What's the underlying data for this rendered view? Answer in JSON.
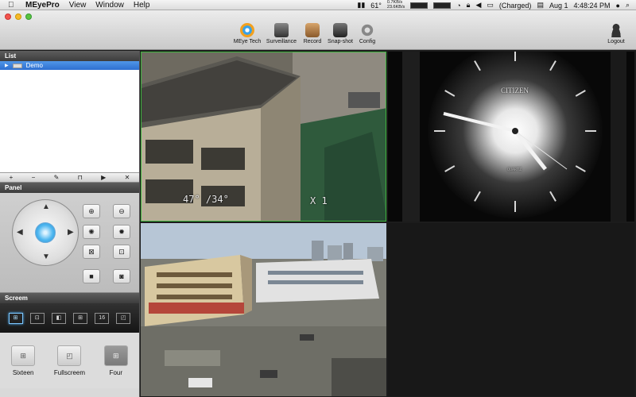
{
  "menubar": {
    "app_name": "MEyePro",
    "items": [
      "View",
      "Window",
      "Help"
    ],
    "temperature": "61°",
    "net_up": "0.7KB/s",
    "net_down": "23.6KB/s",
    "battery": "(Charged)",
    "date": "Aug 1",
    "time": "4:48:24 PM"
  },
  "toolbar": {
    "meye_tech": "MEye Tech",
    "surveillance": "Surveillance",
    "record": "Record",
    "snapshot": "Snap-shot",
    "config": "Config",
    "logout": "Logout"
  },
  "sidebar": {
    "list_header": "List",
    "device": "Demo",
    "panel_header": "Panel",
    "screem_header": "Screem",
    "layouts": [
      "⊞",
      "⊡",
      "◧",
      "⊞",
      "16",
      "◰"
    ],
    "bottom": {
      "sixteen": "Sixteen",
      "fullscreen": "Fullscreem",
      "four": "Four"
    }
  },
  "video": {
    "cam1_osd_left": "47° /34°",
    "cam1_osd_right": "X 1",
    "clock_brand": "CITIZEN",
    "clock_quartz": "QUARTZ"
  },
  "colors": {
    "selection_blue": "#2e6fd0",
    "active_tile_border": "#3db43d",
    "screem_active": "#7ec8ff"
  }
}
